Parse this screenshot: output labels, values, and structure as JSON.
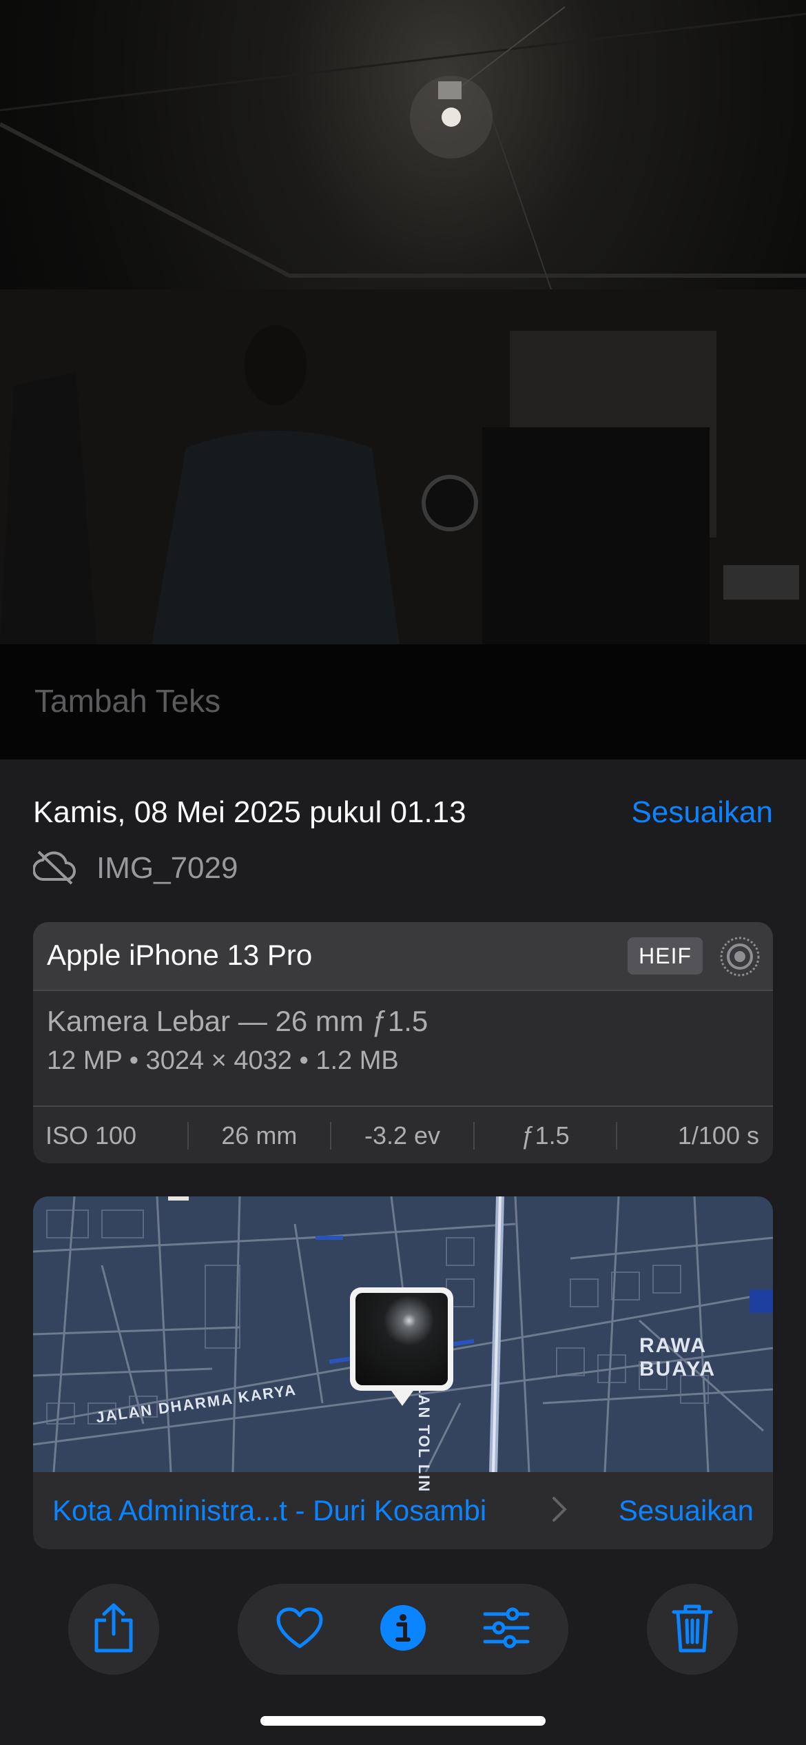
{
  "photo": {
    "description_icon": "photo-icon"
  },
  "caption": {
    "placeholder": "Tambah Teks"
  },
  "info": {
    "date": "Kamis, 08 Mei 2025 pukul 01.13",
    "adjust_label": "Sesuaikan",
    "filename": "IMG_7029",
    "cloud_icon": "cloud-off-icon"
  },
  "camera": {
    "device": "Apple iPhone 13 Pro",
    "format_badge": "HEIF",
    "live_icon": "live-photo-icon",
    "lens": "Kamera Lebar — 26 mm ƒ1.5",
    "specs": "12 MP  •  3024 × 4032  •  1.2 MB",
    "exif": [
      "ISO 100",
      "26 mm",
      "-3.2 ev",
      "ƒ1.5",
      "1/100 s"
    ]
  },
  "map": {
    "labels": {
      "road1": "JALAN DHARMA KARYA",
      "road2": "JALAN TOL LIN",
      "area": "RAWA BUAYA"
    },
    "location": "Kota Administra...t - Duri Kosambi",
    "adjust_label": "Sesuaikan"
  },
  "toolbar": {
    "share_icon": "share-icon",
    "favorite_icon": "heart-icon",
    "info_icon": "info-icon",
    "edit_icon": "sliders-icon",
    "delete_icon": "trash-icon",
    "accent": "#0a84ff"
  }
}
